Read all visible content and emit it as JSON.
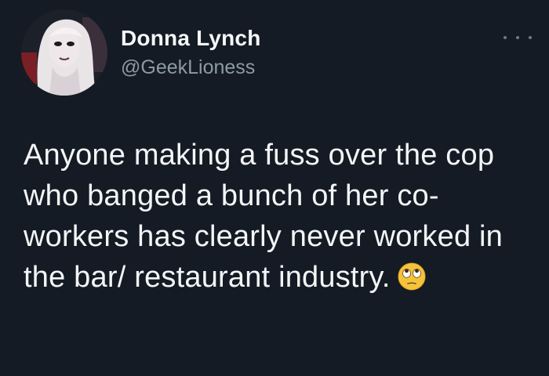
{
  "tweet": {
    "author": {
      "display_name": "Donna Lynch",
      "handle": "@GeekLioness",
      "avatar_icon": "profile-photo"
    },
    "menu_icon": "more-options-icon",
    "text": "Anyone making a fuss over the cop who banged a bunch of her co-workers has clearly never worked in the bar/ restaurant industry.",
    "emoji": "face-with-rolling-eyes"
  },
  "colors": {
    "background": "#141b24",
    "primary_text": "#f3f5f7",
    "secondary_text": "#8e9aa6"
  }
}
